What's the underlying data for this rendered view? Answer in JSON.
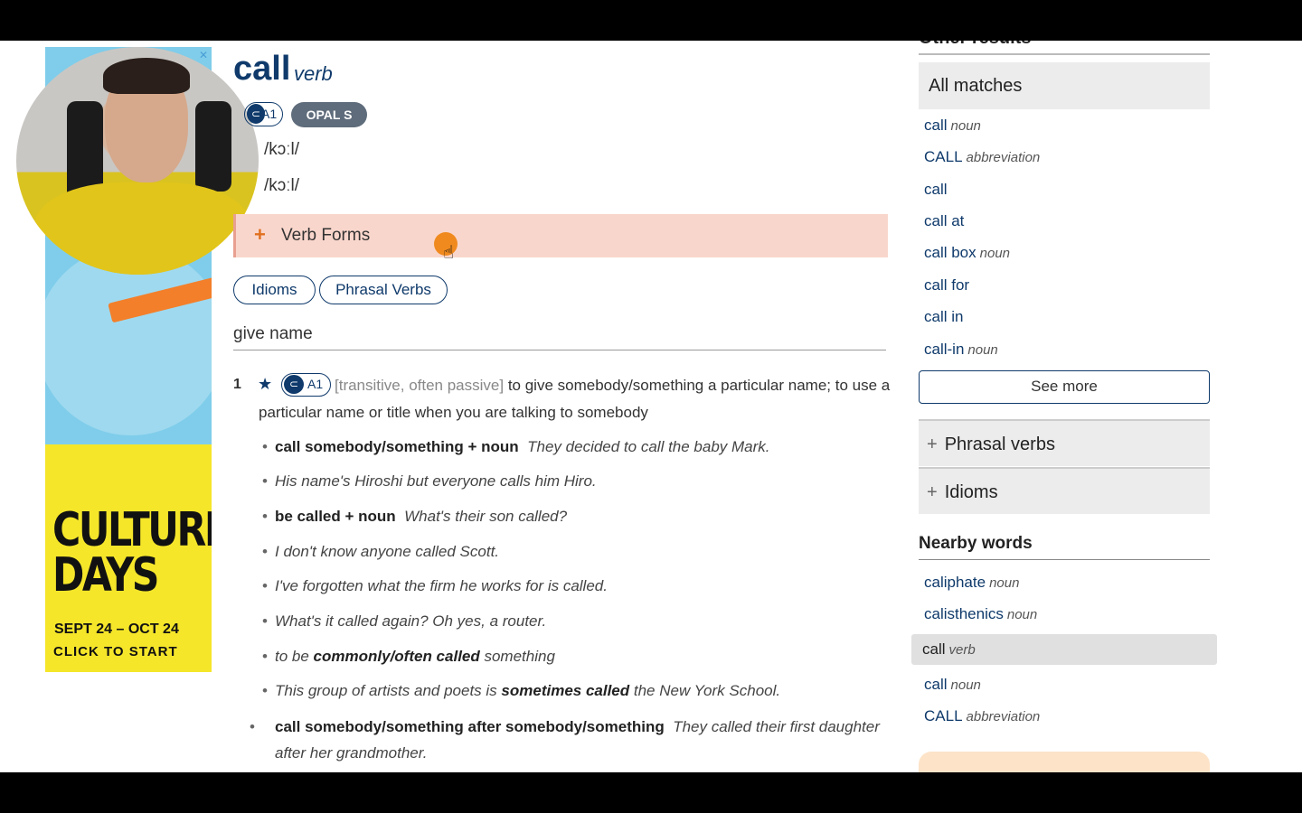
{
  "entry": {
    "headword": "call",
    "pos": "verb",
    "level_badge": "A1",
    "opal_badge": "OPAL S",
    "pronunciations": [
      "/kɔːl/",
      "/kɔːl/"
    ],
    "verb_forms_label": "Verb Forms",
    "pills": [
      "Idioms",
      "Phrasal Verbs"
    ],
    "section_head": "give name",
    "sense": {
      "number": "1",
      "level_badge": "A1",
      "grammar": "[transitive, often passive]",
      "definition": "to give somebody/something a particular name; to use a particular name or title when you are talking to somebody"
    },
    "examples": [
      {
        "cf": "call somebody/something + noun",
        "text": "They decided to call the baby Mark."
      },
      {
        "text": "His name's Hiroshi but everyone calls him Hiro."
      },
      {
        "cf": "be called + noun",
        "text": "What's their son called?"
      },
      {
        "text": "I don't know anyone called Scott."
      },
      {
        "text": "I've forgotten what the firm he works for is called."
      },
      {
        "text": "What's it called again? Oh yes, a router."
      },
      {
        "pre": "to be ",
        "bold": "commonly/often called",
        "post": " something"
      },
      {
        "pre": "This group of artists and poets is ",
        "bold": "sometimes called",
        "post": " the New York School."
      },
      {
        "cf": "call somebody/something after somebody/something",
        "text": "They called their first daughter after her grandmother."
      }
    ]
  },
  "sidebar": {
    "other_results_title": "Other results",
    "all_matches_label": "All matches",
    "matches": [
      {
        "word": "call",
        "pos": "noun"
      },
      {
        "word": "CALL",
        "pos": "abbreviation"
      },
      {
        "word": "call",
        "pos": ""
      },
      {
        "word": "call at",
        "pos": ""
      },
      {
        "word": "call box",
        "pos": "noun"
      },
      {
        "word": "call for",
        "pos": ""
      },
      {
        "word": "call in",
        "pos": ""
      },
      {
        "word": "call-in",
        "pos": "noun"
      }
    ],
    "see_more_label": "See more",
    "phrasal_verbs_label": "Phrasal verbs",
    "idioms_label": "Idioms",
    "nearby_title": "Nearby words",
    "nearby": [
      {
        "word": "caliphate",
        "pos": "noun"
      },
      {
        "word": "calisthenics",
        "pos": "noun"
      },
      {
        "word": "call",
        "pos": "verb",
        "current": true
      },
      {
        "word": "call",
        "pos": "noun"
      },
      {
        "word": "CALL",
        "pos": "abbreviation"
      }
    ]
  },
  "ad": {
    "title_line1": "CULTURE",
    "title_line2": "DAYS",
    "dates": "SEPT 24 – OCT 24",
    "cta": "CLICK TO START",
    "close_icon": "close-icon"
  },
  "colors": {
    "link": "#0f3a6b",
    "verb_forms_bg": "#f9d6cc",
    "ad_yellow": "#f5e62a",
    "accent_orange": "#f08a1e"
  }
}
